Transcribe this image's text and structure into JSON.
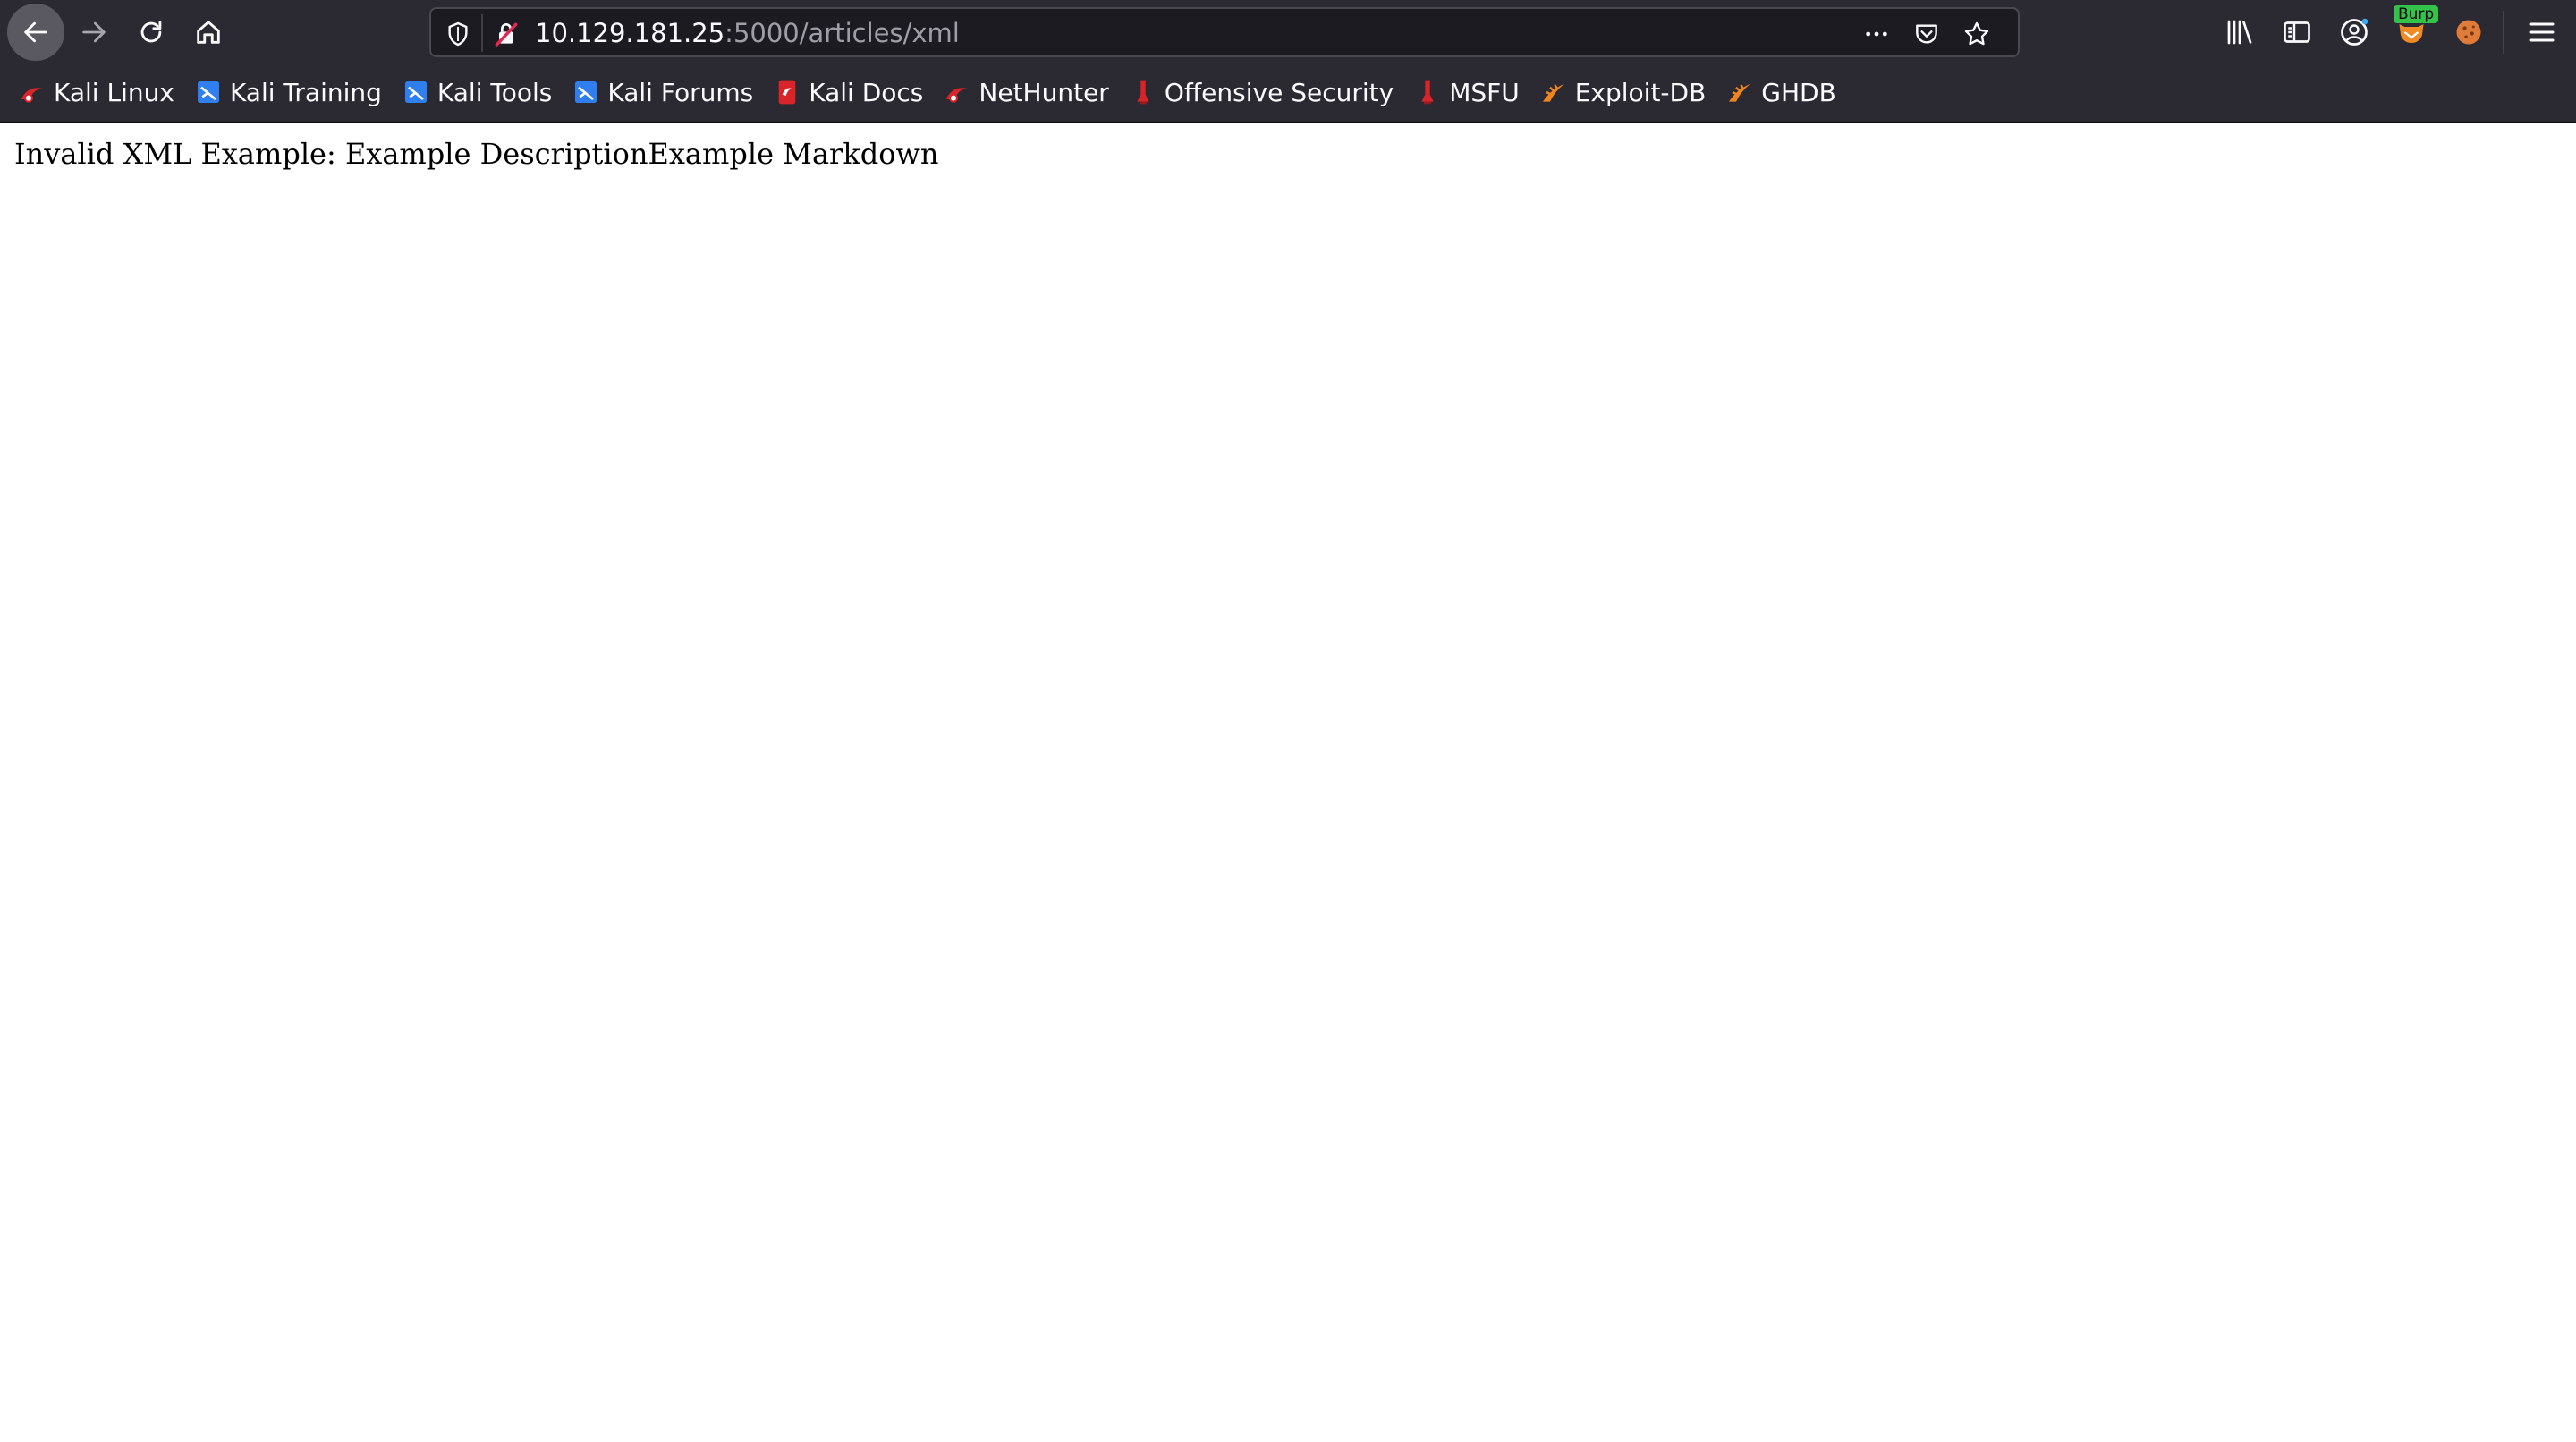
{
  "browser": {
    "url": {
      "host": "10.129.181.25",
      "rest": ":5000/articles/xml"
    },
    "extension_badge": "Burp",
    "icons": {
      "back": "arrow-left-icon",
      "forward": "arrow-right-icon",
      "reload": "reload-icon",
      "home": "home-icon",
      "shield": "shield-icon",
      "insecure": "insecure-lock-icon",
      "page_actions": "more-horizontal-icon",
      "pocket": "pocket-icon",
      "bookmark": "star-icon",
      "library": "library-icon",
      "sidebar": "sidebar-icon",
      "account": "account-icon",
      "foxyproxy": "fox-icon",
      "cookie": "cookie-icon",
      "menu": "hamburger-menu-icon"
    }
  },
  "bookmarks": [
    {
      "label": "Kali Linux",
      "icon": "kali-dragon-icon"
    },
    {
      "label": "Kali Training",
      "icon": "kali-training-icon"
    },
    {
      "label": "Kali Tools",
      "icon": "kali-tools-icon"
    },
    {
      "label": "Kali Forums",
      "icon": "kali-forums-icon"
    },
    {
      "label": "Kali Docs",
      "icon": "kali-docs-icon"
    },
    {
      "label": "NetHunter",
      "icon": "kali-dragon-icon"
    },
    {
      "label": "Offensive Security",
      "icon": "offsec-icon"
    },
    {
      "label": "MSFU",
      "icon": "offsec-icon"
    },
    {
      "label": "Exploit-DB",
      "icon": "exploit-db-icon"
    },
    {
      "label": "GHDB",
      "icon": "exploit-db-icon"
    }
  ],
  "page": {
    "body_text": "Invalid XML Example: Example DescriptionExample Markdown"
  },
  "colors": {
    "toolbar_bg": "#2b2a33",
    "urlbar_bg": "#1c1b22",
    "page_bg": "#ffffff",
    "kali_red": "#d9252a",
    "kali_blue": "#2f7ff0",
    "exploit_orange": "#f0851d"
  }
}
